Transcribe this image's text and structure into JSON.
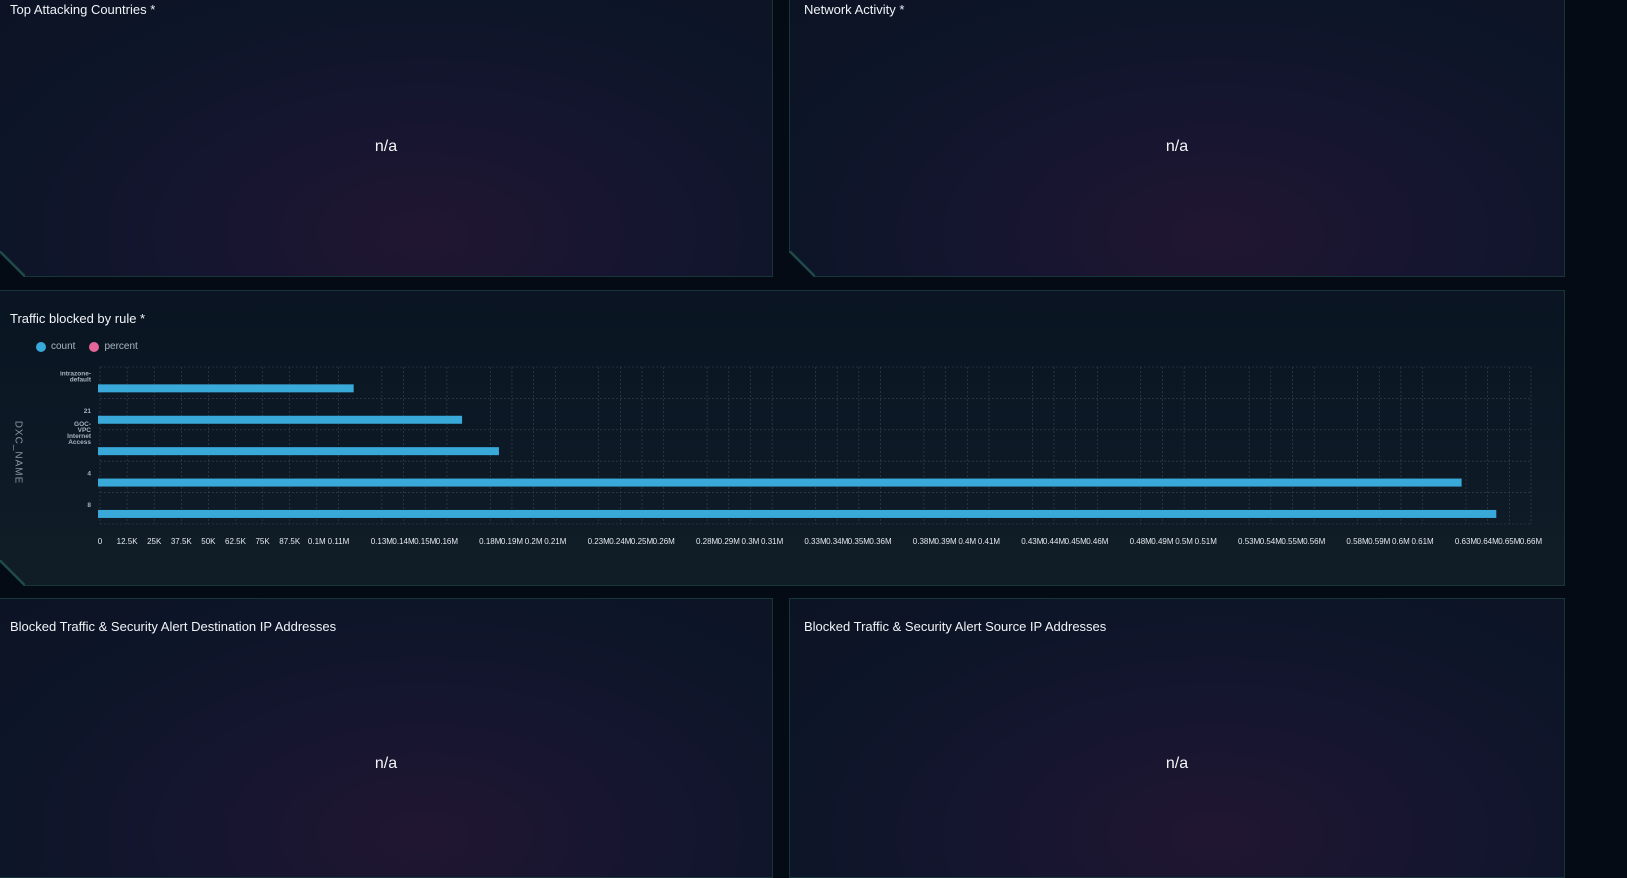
{
  "panels": {
    "top_attacking_countries": {
      "title": "Top Attacking Countries *",
      "value": "n/a"
    },
    "network_activity": {
      "title": "Network Activity *",
      "value": "n/a"
    },
    "traffic_blocked_by_rule": {
      "title": "Traffic blocked by rule *"
    },
    "blocked_dest_ips": {
      "title": "Blocked Traffic & Security Alert Destination IP Addresses",
      "value": "n/a"
    },
    "blocked_src_ips": {
      "title": "Blocked Traffic & Security Alert Source IP Addresses",
      "value": "n/a"
    }
  },
  "chart_data": {
    "type": "bar",
    "orientation": "horizontal",
    "categories": [
      [
        "intrazone-",
        "default"
      ],
      [
        "21"
      ],
      [
        "GOC-",
        "VPC",
        "Internet",
        "Access"
      ],
      [
        "4"
      ],
      [
        "8"
      ]
    ],
    "series": [
      {
        "name": "count",
        "color": "#39a9d9",
        "values": [
          117000,
          167000,
          184000,
          628000,
          644000
        ]
      },
      {
        "name": "percent",
        "color": "#e7669a",
        "values": []
      }
    ],
    "ylabel": "DXC_NAME",
    "xlim": [
      0,
      660000
    ],
    "xticks": [
      {
        "v": 0,
        "l": "0"
      },
      {
        "v": 12500,
        "l": "12.5K"
      },
      {
        "v": 25000,
        "l": "25K"
      },
      {
        "v": 37500,
        "l": "37.5K"
      },
      {
        "v": 50000,
        "l": "50K"
      },
      {
        "v": 62500,
        "l": "62.5K"
      },
      {
        "v": 75000,
        "l": "75K"
      },
      {
        "v": 87500,
        "l": "87.5K"
      },
      {
        "v": 100000,
        "l": "0.1M"
      },
      {
        "v": 110000,
        "l": "0.11M"
      },
      {
        "v": 130000,
        "l": "0.13M"
      },
      {
        "v": 140000,
        "l": "0.14M"
      },
      {
        "v": 150000,
        "l": "0.15M"
      },
      {
        "v": 160000,
        "l": "0.16M"
      },
      {
        "v": 180000,
        "l": "0.18M"
      },
      {
        "v": 190000,
        "l": "0.19M"
      },
      {
        "v": 200000,
        "l": "0.2M"
      },
      {
        "v": 210000,
        "l": "0.21M"
      },
      {
        "v": 230000,
        "l": "0.23M"
      },
      {
        "v": 240000,
        "l": "0.24M"
      },
      {
        "v": 250000,
        "l": "0.25M"
      },
      {
        "v": 260000,
        "l": "0.26M"
      },
      {
        "v": 280000,
        "l": "0.28M"
      },
      {
        "v": 290000,
        "l": "0.29M"
      },
      {
        "v": 300000,
        "l": "0.3M"
      },
      {
        "v": 310000,
        "l": "0.31M"
      },
      {
        "v": 330000,
        "l": "0.33M"
      },
      {
        "v": 340000,
        "l": "0.34M"
      },
      {
        "v": 350000,
        "l": "0.35M"
      },
      {
        "v": 360000,
        "l": "0.36M"
      },
      {
        "v": 380000,
        "l": "0.38M"
      },
      {
        "v": 390000,
        "l": "0.39M"
      },
      {
        "v": 400000,
        "l": "0.4M"
      },
      {
        "v": 410000,
        "l": "0.41M"
      },
      {
        "v": 430000,
        "l": "0.43M"
      },
      {
        "v": 440000,
        "l": "0.44M"
      },
      {
        "v": 450000,
        "l": "0.45M"
      },
      {
        "v": 460000,
        "l": "0.46M"
      },
      {
        "v": 480000,
        "l": "0.48M"
      },
      {
        "v": 490000,
        "l": "0.49M"
      },
      {
        "v": 500000,
        "l": "0.5M"
      },
      {
        "v": 510000,
        "l": "0.51M"
      },
      {
        "v": 530000,
        "l": "0.53M"
      },
      {
        "v": 540000,
        "l": "0.54M"
      },
      {
        "v": 550000,
        "l": "0.55M"
      },
      {
        "v": 560000,
        "l": "0.56M"
      },
      {
        "v": 580000,
        "l": "0.58M"
      },
      {
        "v": 590000,
        "l": "0.59M"
      },
      {
        "v": 600000,
        "l": "0.6M"
      },
      {
        "v": 610000,
        "l": "0.61M"
      },
      {
        "v": 630000,
        "l": "0.63M"
      },
      {
        "v": 640000,
        "l": "0.64M"
      },
      {
        "v": 650000,
        "l": "0.65M"
      },
      {
        "v": 660000,
        "l": "0.66M"
      }
    ],
    "grid": true,
    "legend_position": "top-left"
  }
}
